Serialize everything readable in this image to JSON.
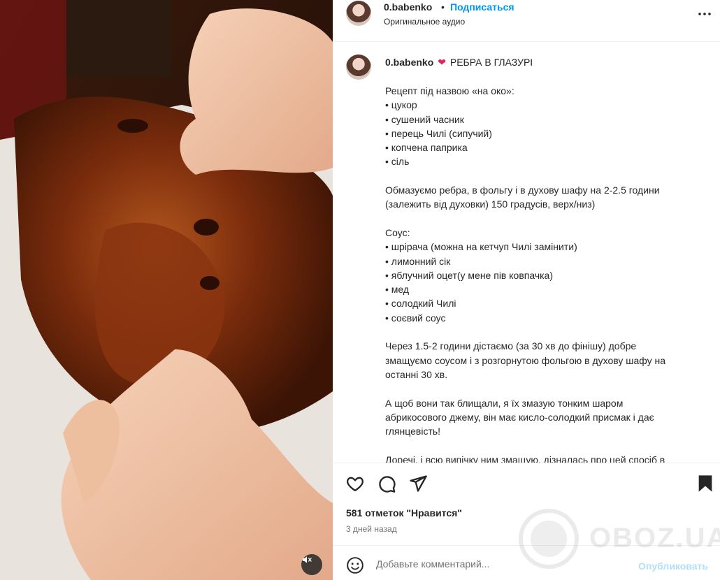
{
  "post": {
    "username": "0.babenko",
    "dot": "•",
    "follow_label": "Подписаться",
    "audio_label": "Оригинальное аудио"
  },
  "caption": {
    "username": "0.babenko",
    "emoji": "❤",
    "title": "РЕБРА В ГЛАЗУРІ",
    "body": "Рецепт під назвою «на око»:\n• цукор\n• сушений часник\n• перець Чилі (сипучий)\n• копчена паприка\n• сіль\n\nОбмазуємо ребра, в фольгу і в духову шафу на 2-2.5 години\n(залежить від духовки) 150 градусів, верх/низ)\n\nСоус:\n• шрірача (можна на кетчуп Чилі замінити)\n• лимонний сік\n• яблучний оцет(у мене пів ковпачка)\n• мед\n• солодкий Чилі\n• соєвий соус\n\nЧерез 1.5-2 години дістаємо (за 30 хв до фінішу) добре\nзмащуємо соусом і з розгорнутою фольгою в духову шафу на\nостанні 30 хв.\n\nА щоб вони так блищали, я їх змазую тонким шаром\nабрикосового джему, він має кисло-солодкий присмак і дає\nглянцевість!\n\nДоречі, і всю випічку ним змащую, дізналась про цей спосіб в"
  },
  "stats": {
    "likes": "581 отметок \"Нравится\"",
    "time_ago": "3 дней назад"
  },
  "comment": {
    "placeholder": "Добавьте комментарий...",
    "publish_label": "Опубликовать"
  },
  "watermark": {
    "text": "OBOZ.UA"
  },
  "icons": {
    "more": "more-horizontal-icon",
    "like": "heart-icon",
    "comment": "comment-icon",
    "share": "send-icon",
    "save": "bookmark-icon",
    "emoji": "emoji-icon",
    "mute": "speaker-muted-icon"
  },
  "colors": {
    "link": "#0095f6",
    "publish_disabled": "#b2dffc",
    "text": "#262626",
    "secondary": "#737373"
  }
}
